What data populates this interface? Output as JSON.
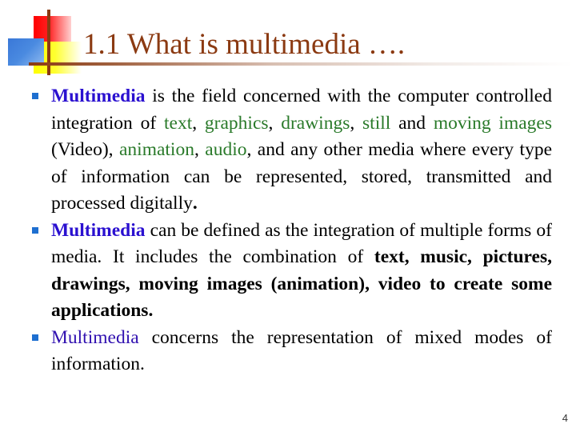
{
  "slide": {
    "title": "1.1 What is multimedia ….",
    "page_number": "4",
    "colors": {
      "title": "#8b3a12",
      "keyword_blue": "#2a10d0",
      "highlight_green": "#2a7a2a",
      "bullet": "#1e6fd0"
    },
    "bullets": [
      {
        "segments": [
          {
            "text": "Multimedia",
            "style": "blue-bold"
          },
          {
            "text": " is the field concerned with the computer controlled integration of ",
            "style": "normal"
          },
          {
            "text": "text",
            "style": "green"
          },
          {
            "text": ", ",
            "style": "normal"
          },
          {
            "text": "graphics",
            "style": "green"
          },
          {
            "text": ", ",
            "style": "normal"
          },
          {
            "text": "drawings",
            "style": "green"
          },
          {
            "text": ", ",
            "style": "normal"
          },
          {
            "text": "still",
            "style": "green"
          },
          {
            "text": " and ",
            "style": "normal"
          },
          {
            "text": "moving images",
            "style": "green"
          },
          {
            "text": " (Video), ",
            "style": "normal"
          },
          {
            "text": "animation",
            "style": "green"
          },
          {
            "text": ", ",
            "style": "normal"
          },
          {
            "text": "audio",
            "style": "green"
          },
          {
            "text": ", and any other media where every type of information can be represented, stored, transmitted and processed digitally",
            "style": "normal"
          },
          {
            "text": ".",
            "style": "bold"
          }
        ]
      },
      {
        "segments": [
          {
            "text": "Multimedia",
            "style": "blue-bold"
          },
          {
            "text": " can be defined as the integration of multiple forms of media. It includes the combination of ",
            "style": "normal"
          },
          {
            "text": "text, music, pictures, drawings, moving images (animation), video to create some applications.",
            "style": "bold"
          }
        ]
      },
      {
        "segments": [
          {
            "text": "Multimedia",
            "style": "blue-reg"
          },
          {
            "text": " concerns the representation of mixed modes of information.",
            "style": "normal"
          }
        ]
      }
    ]
  }
}
